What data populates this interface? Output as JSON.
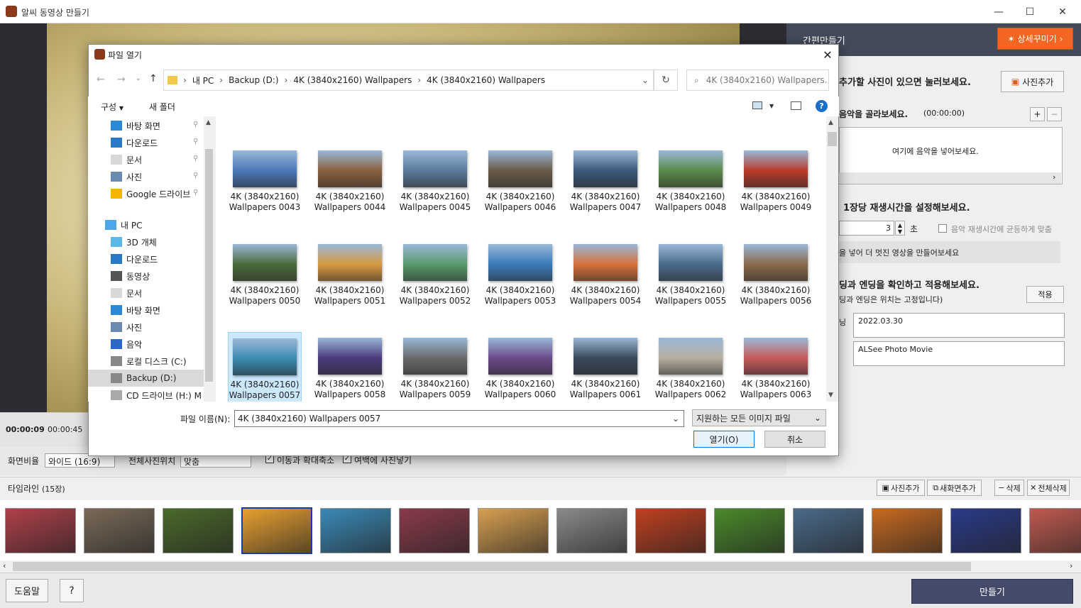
{
  "app": {
    "title": "알씨 동영상 만들기"
  },
  "window": {
    "minimize": "—",
    "maximize": "☐",
    "close": "✕"
  },
  "player": {
    "current_time": "00:00:09",
    "total_time": "00:00:45"
  },
  "options": {
    "ratio_label": "화면비율",
    "ratio_value": "와이드 (16:9)",
    "position_label": "전체사진위치",
    "position_value": "맞춤",
    "zoom_label": "이동과 확대축소",
    "margin_label": "여백에 사진넣기"
  },
  "right_panel": {
    "title": "간편만들기",
    "detail_button": "상세꾸미기",
    "step1": "추가할 사진이 있으면 눌러보세요.",
    "add_photo": "사진추가",
    "step2": "음악을 골라보세요.",
    "step2_time": "(00:00:00)",
    "music_placeholder": "여기에 음악을 넣어보세요.",
    "step3": "1장당 재생시간을 설정해보세요.",
    "duration_value": "3",
    "duration_unit": "초",
    "fit_music": "음악 재생시간에 균등하게 맞춤",
    "tip": "을 넣어 더 멋진 영상을 만들어보세요",
    "step4": "딩과 엔딩을 확인하고 적용해보세요.",
    "step4_note": "딩과 엔딩은 위치는 고정입니다)",
    "apply": "적용",
    "opening_label": "닝",
    "opening_text": "2022.03.30",
    "ending_text": "ALSee Photo Movie"
  },
  "timeline": {
    "label": "타임라인",
    "count": "(15장)",
    "add_photo": "사진추가",
    "new_screen": "새화면추가",
    "delete": "삭제",
    "delete_all": "전체삭제",
    "thumbs": [
      "#b0404a",
      "#7a6a58",
      "#4a6a2a",
      "#e8a030",
      "#3a8ab8",
      "#8a3a4a",
      "#d8a050",
      "#8a8a8a",
      "#c04020",
      "#4a8a2a",
      "#4a6a8a",
      "#c86a20",
      "#2a3a8a",
      "#c05a50"
    ]
  },
  "footer": {
    "help": "도움말",
    "question": "?",
    "make": "만들기"
  },
  "dialog": {
    "title": "파일 열기",
    "breadcrumb": [
      "내 PC",
      "Backup (D:)",
      "4K (3840x2160) Wallpapers",
      "4K (3840x2160) Wallpapers"
    ],
    "search_placeholder": "4K (3840x2160) Wallpapers...",
    "organize": "구성",
    "new_folder": "새 폴더",
    "nav": [
      {
        "label": "바탕 화면",
        "icon": "desktop-icon",
        "pin": true
      },
      {
        "label": "다운로드",
        "icon": "download-icon",
        "pin": true
      },
      {
        "label": "문서",
        "icon": "document-icon",
        "pin": true
      },
      {
        "label": "사진",
        "icon": "pictures-icon",
        "pin": true
      },
      {
        "label": "Google 드라이브",
        "icon": "google-drive-icon",
        "pin": true
      },
      {
        "label": "내 PC",
        "icon": "pc-icon",
        "pin": false
      },
      {
        "label": "3D 개체",
        "icon": "3d-objects-icon",
        "pin": false
      },
      {
        "label": "다운로드",
        "icon": "download-icon",
        "pin": false
      },
      {
        "label": "동영상",
        "icon": "video-icon",
        "pin": false
      },
      {
        "label": "문서",
        "icon": "document-icon",
        "pin": false
      },
      {
        "label": "바탕 화면",
        "icon": "desktop-icon",
        "pin": false
      },
      {
        "label": "사진",
        "icon": "pictures-icon",
        "pin": false
      },
      {
        "label": "음악",
        "icon": "music-icon",
        "pin": false
      },
      {
        "label": "로컬 디스크 (C:)",
        "icon": "disk-icon",
        "pin": false
      },
      {
        "label": "Backup (D:)",
        "icon": "disk-icon",
        "pin": false,
        "selected": true
      },
      {
        "label": "CD 드라이브 (H:) M",
        "icon": "cd-drive-icon",
        "pin": false
      }
    ],
    "files": [
      {
        "line1": "4K (3840x2160)",
        "line2": "Wallpapers 0043"
      },
      {
        "line1": "4K (3840x2160)",
        "line2": "Wallpapers 0044"
      },
      {
        "line1": "4K (3840x2160)",
        "line2": "Wallpapers 0045"
      },
      {
        "line1": "4K (3840x2160)",
        "line2": "Wallpapers 0046"
      },
      {
        "line1": "4K (3840x2160)",
        "line2": "Wallpapers 0047"
      },
      {
        "line1": "4K (3840x2160)",
        "line2": "Wallpapers 0048"
      },
      {
        "line1": "4K (3840x2160)",
        "line2": "Wallpapers 0049"
      },
      {
        "line1": "4K (3840x2160)",
        "line2": "Wallpapers 0050"
      },
      {
        "line1": "4K (3840x2160)",
        "line2": "Wallpapers 0051"
      },
      {
        "line1": "4K (3840x2160)",
        "line2": "Wallpapers 0052"
      },
      {
        "line1": "4K (3840x2160)",
        "line2": "Wallpapers 0053"
      },
      {
        "line1": "4K (3840x2160)",
        "line2": "Wallpapers 0054"
      },
      {
        "line1": "4K (3840x2160)",
        "line2": "Wallpapers 0055"
      },
      {
        "line1": "4K (3840x2160)",
        "line2": "Wallpapers 0056"
      },
      {
        "line1": "4K (3840x2160)",
        "line2": "Wallpapers 0057",
        "selected": true
      },
      {
        "line1": "4K (3840x2160)",
        "line2": "Wallpapers 0058"
      },
      {
        "line1": "4K (3840x2160)",
        "line2": "Wallpapers 0059"
      },
      {
        "line1": "4K (3840x2160)",
        "line2": "Wallpapers 0060"
      },
      {
        "line1": "4K (3840x2160)",
        "line2": "Wallpapers 0061"
      },
      {
        "line1": "4K (3840x2160)",
        "line2": "Wallpapers 0062"
      },
      {
        "line1": "4K (3840x2160)",
        "line2": "Wallpapers 0063"
      }
    ],
    "file_colors": [
      "#4a78b8",
      "#8a6040",
      "#5a7a9a",
      "#6a5a48",
      "#3a5878",
      "#5a8a4a",
      "#b83a2a",
      "#4a6a3a",
      "#d89a40",
      "#5a9a6a",
      "#3a7ab8",
      "#d8703a",
      "#4a6a8a",
      "#8a6a4a",
      "#3a8ab0",
      "#4a3a7a",
      "#6a6a6a",
      "#6a4a8a",
      "#3a4a5a",
      "#b8b0a0",
      "#c85a5a"
    ],
    "filename_label": "파일 이름(N):",
    "filename_value": "4K (3840x2160) Wallpapers 0057",
    "filetype": "지원하는 모든 이미지 파일",
    "open": "열기(O)",
    "cancel": "취소"
  }
}
